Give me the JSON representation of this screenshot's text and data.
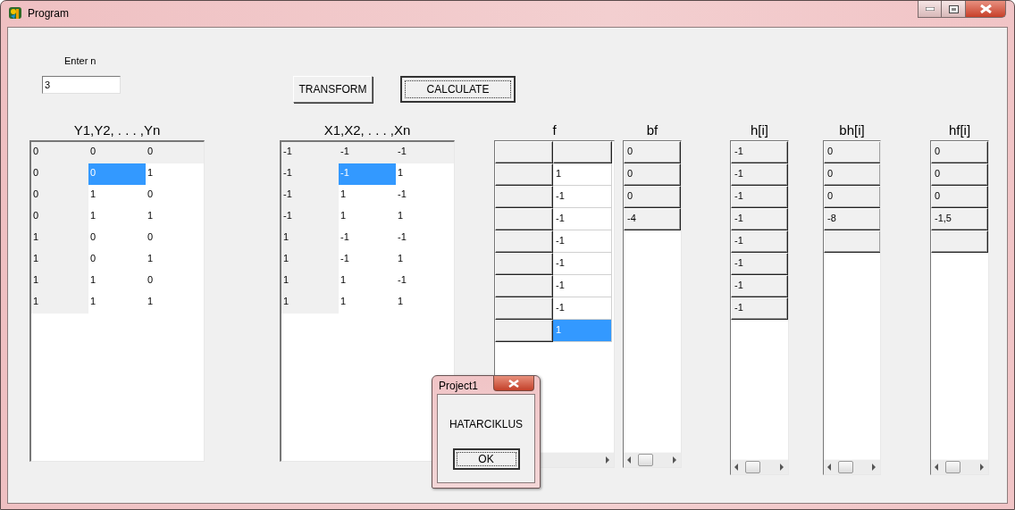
{
  "window": {
    "title": "Program"
  },
  "input": {
    "label": "Enter n",
    "value": "3"
  },
  "buttons": [
    {
      "label": "TRANSFORM",
      "default": false
    },
    {
      "label": "CALCULATE",
      "default": true
    }
  ],
  "grids": [
    {
      "title": "Y1,Y2, . . . ,Yn",
      "kind": "matrix",
      "rows": [
        {
          "cells": [
            {
              "text": "0",
              "selected": false
            },
            {
              "text": "0",
              "selected": false
            },
            {
              "text": "0",
              "selected": false
            }
          ]
        },
        {
          "cells": [
            {
              "text": "0",
              "selected": false
            },
            {
              "text": "0",
              "selected": true
            },
            {
              "text": "1",
              "selected": false
            }
          ]
        },
        {
          "cells": [
            {
              "text": "0",
              "selected": false
            },
            {
              "text": "1",
              "selected": false
            },
            {
              "text": "0",
              "selected": false
            }
          ]
        },
        {
          "cells": [
            {
              "text": "0",
              "selected": false
            },
            {
              "text": "1",
              "selected": false
            },
            {
              "text": "1",
              "selected": false
            }
          ]
        },
        {
          "cells": [
            {
              "text": "1",
              "selected": false
            },
            {
              "text": "0",
              "selected": false
            },
            {
              "text": "0",
              "selected": false
            }
          ]
        },
        {
          "cells": [
            {
              "text": "1",
              "selected": false
            },
            {
              "text": "0",
              "selected": false
            },
            {
              "text": "1",
              "selected": false
            }
          ]
        },
        {
          "cells": [
            {
              "text": "1",
              "selected": false
            },
            {
              "text": "1",
              "selected": false
            },
            {
              "text": "0",
              "selected": false
            }
          ]
        },
        {
          "cells": [
            {
              "text": "1",
              "selected": false
            },
            {
              "text": "1",
              "selected": false
            },
            {
              "text": "1",
              "selected": false
            }
          ]
        }
      ]
    },
    {
      "title": "X1,X2, . . . ,Xn",
      "kind": "matrix",
      "rows": [
        {
          "cells": [
            {
              "text": "-1",
              "selected": false
            },
            {
              "text": "-1",
              "selected": false
            },
            {
              "text": "-1",
              "selected": false
            }
          ]
        },
        {
          "cells": [
            {
              "text": "-1",
              "selected": false
            },
            {
              "text": "-1",
              "selected": true
            },
            {
              "text": "1",
              "selected": false
            }
          ]
        },
        {
          "cells": [
            {
              "text": "-1",
              "selected": false
            },
            {
              "text": "1",
              "selected": false
            },
            {
              "text": "-1",
              "selected": false
            }
          ]
        },
        {
          "cells": [
            {
              "text": "-1",
              "selected": false
            },
            {
              "text": "1",
              "selected": false
            },
            {
              "text": "1",
              "selected": false
            }
          ]
        },
        {
          "cells": [
            {
              "text": "1",
              "selected": false
            },
            {
              "text": "-1",
              "selected": false
            },
            {
              "text": "-1",
              "selected": false
            }
          ]
        },
        {
          "cells": [
            {
              "text": "1",
              "selected": false
            },
            {
              "text": "-1",
              "selected": false
            },
            {
              "text": "1",
              "selected": false
            }
          ]
        },
        {
          "cells": [
            {
              "text": "1",
              "selected": false
            },
            {
              "text": "1",
              "selected": false
            },
            {
              "text": "-1",
              "selected": false
            }
          ]
        },
        {
          "cells": [
            {
              "text": "1",
              "selected": false
            },
            {
              "text": "1",
              "selected": false
            },
            {
              "text": "1",
              "selected": false
            }
          ]
        }
      ]
    },
    {
      "title": "f",
      "kind": "fixed_col",
      "rows": [
        {
          "cells": [
            {
              "text": "1",
              "selected": false
            }
          ]
        },
        {
          "cells": [
            {
              "text": "-1",
              "selected": false
            }
          ]
        },
        {
          "cells": [
            {
              "text": "-1",
              "selected": false
            }
          ]
        },
        {
          "cells": [
            {
              "text": "-1",
              "selected": false
            }
          ]
        },
        {
          "cells": [
            {
              "text": "-1",
              "selected": false
            }
          ]
        },
        {
          "cells": [
            {
              "text": "-1",
              "selected": false
            }
          ]
        },
        {
          "cells": [
            {
              "text": "-1",
              "selected": false
            }
          ]
        },
        {
          "cells": [
            {
              "text": "1",
              "selected": true
            }
          ]
        }
      ]
    },
    {
      "title": "bf",
      "kind": "list",
      "cells": [
        "0",
        "0",
        "0",
        "-4"
      ]
    },
    {
      "title": "h[i]",
      "kind": "list",
      "cells": [
        "-1",
        "-1",
        "-1",
        "-1",
        "-1",
        "-1",
        "-1",
        "-1"
      ]
    },
    {
      "title": "bh[i]",
      "kind": "list",
      "cells": [
        "0",
        "0",
        "0",
        "-8"
      ],
      "blank_row": true
    },
    {
      "title": "hf[i]",
      "kind": "list",
      "cells": [
        "0",
        "0",
        "0",
        "-1,5"
      ],
      "blank_row": true
    }
  ],
  "dialog": {
    "title": "Project1",
    "message": "HATARCIKLUS",
    "button": {
      "label": "OK",
      "default": true
    }
  }
}
